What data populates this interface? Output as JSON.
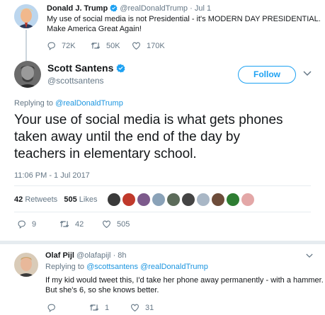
{
  "parent_tweet": {
    "name": "Donald J. Trump",
    "handle": "@realDonaldTrump",
    "separator": "·",
    "date": "Jul 1",
    "text_line1": "My use of social media is not Presidential - it's MODERN DAY PRESIDENTIAL.",
    "text_line2": "Make America Great Again!",
    "replies": "72K",
    "retweets": "50K",
    "likes": "170K"
  },
  "main_tweet": {
    "name": "Scott Santens",
    "handle": "@scottsantens",
    "follow_label": "Follow",
    "replying_prefix": "Replying to ",
    "replying_to": "@realDonaldTrump",
    "text_line1": "Your use of social media is what gets phones",
    "text_line2": "taken away until the end of the day by",
    "text_line3": "teachers in elementary school.",
    "timestamp": "11:06 PM - 1 Jul 2017",
    "retweet_count": "42",
    "retweet_label": "Retweets",
    "like_count": "505",
    "like_label": "Likes",
    "replies": "9",
    "retweets": "42",
    "likes": "505"
  },
  "reply_tweet": {
    "name": "Olaf Pijl",
    "handle": "@olafapijl",
    "separator": "·",
    "date": "8h",
    "replying_prefix": "Replying to ",
    "replying_to": "@scottsantens @realDonaldTrump",
    "text_line1": "If my kid would tweet this, I'd take her phone away permanently - with a hammer.",
    "text_line2": "But she's 6, so she knows better.",
    "replies": "",
    "retweets": "1",
    "likes": "31"
  },
  "colors": {
    "accent": "#1da1f2",
    "link": "#1b95e0",
    "muted": "#657786",
    "divider": "#e6ecf0"
  }
}
